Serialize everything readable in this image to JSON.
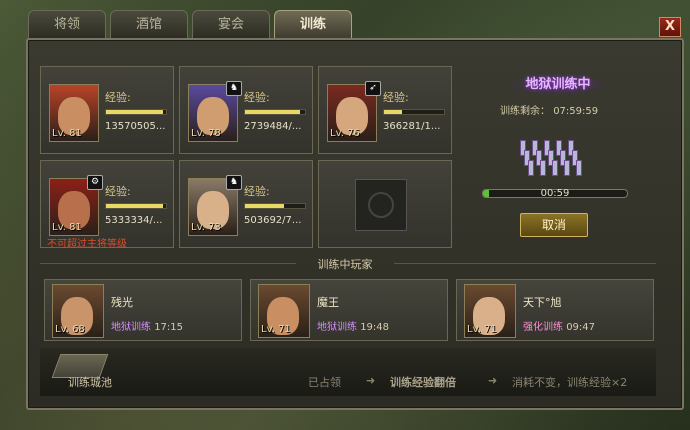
{
  "tabs": [
    {
      "label": "将领",
      "active": false
    },
    {
      "label": "酒馆",
      "active": false
    },
    {
      "label": "宴会",
      "active": false
    },
    {
      "label": "训练",
      "active": true
    }
  ],
  "close_label": "X",
  "slots": [
    {
      "level": "Lv. 81",
      "exp_label": "经验:",
      "exp_value": "13570505...",
      "exp_fraction": 0.95,
      "badge": null,
      "warning": null,
      "face_color": "#c98e62",
      "helmet_color": "#b84328"
    },
    {
      "level": "Lv. 78",
      "exp_label": "经验:",
      "exp_value": "2739484/...",
      "exp_fraction": 0.92,
      "badge": "mount-icon",
      "warning": null,
      "face_color": "#cf9d70",
      "helmet_color": "#5a4aa0"
    },
    {
      "level": "Lv. 76",
      "exp_label": "经验:",
      "exp_value": "366281/1...",
      "exp_fraction": 0.3,
      "badge": "bow-icon",
      "warning": null,
      "face_color": "#d6a67c",
      "helmet_color": "#7a2a20"
    },
    {
      "level": "Lv. 81",
      "exp_label": "经验:",
      "exp_value": "5333334/...",
      "exp_fraction": 0.95,
      "badge": "chariot-icon",
      "warning": "不可超过主将等级",
      "face_color": "#b8704c",
      "helmet_color": "#8c2018"
    },
    {
      "level": "Lv. 73",
      "exp_label": "经验:",
      "exp_value": "503692/7...",
      "exp_fraction": 0.65,
      "badge": "mount-icon",
      "warning": null,
      "face_color": "#d8b08a",
      "helmet_color": "#8a7a68"
    },
    {
      "empty": true
    }
  ],
  "training": {
    "title": "地狱训练中",
    "remaining_label": "训练剩余：",
    "remaining_time": "07:59:59",
    "progress_text": "00:59",
    "progress_fraction": 0.04,
    "cancel_label": "取消"
  },
  "players_section_title": "训练中玩家",
  "players": [
    {
      "name": "残光",
      "mode": "地狱训练",
      "time": "17:15",
      "level": "Lv. 68",
      "mode_color": "#d58cff",
      "face_color": "#c9946a"
    },
    {
      "name": "魔王",
      "mode": "地狱训练",
      "time": "19:48",
      "level": "Lv. 71",
      "mode_color": "#d58cff",
      "face_color": "#c98e62"
    },
    {
      "name": "天下°旭",
      "mode": "强化训练",
      "time": "09:47",
      "level": "Lv. 71",
      "mode_color": "#ff8cd8",
      "face_color": "#d9b08a"
    }
  ],
  "bottom": {
    "city_label": "训练城池",
    "occupied": "已占领",
    "arrow": "➜",
    "double_exp": "训练经验翻倍",
    "cost_note": "消耗不变，训练经验×2"
  }
}
